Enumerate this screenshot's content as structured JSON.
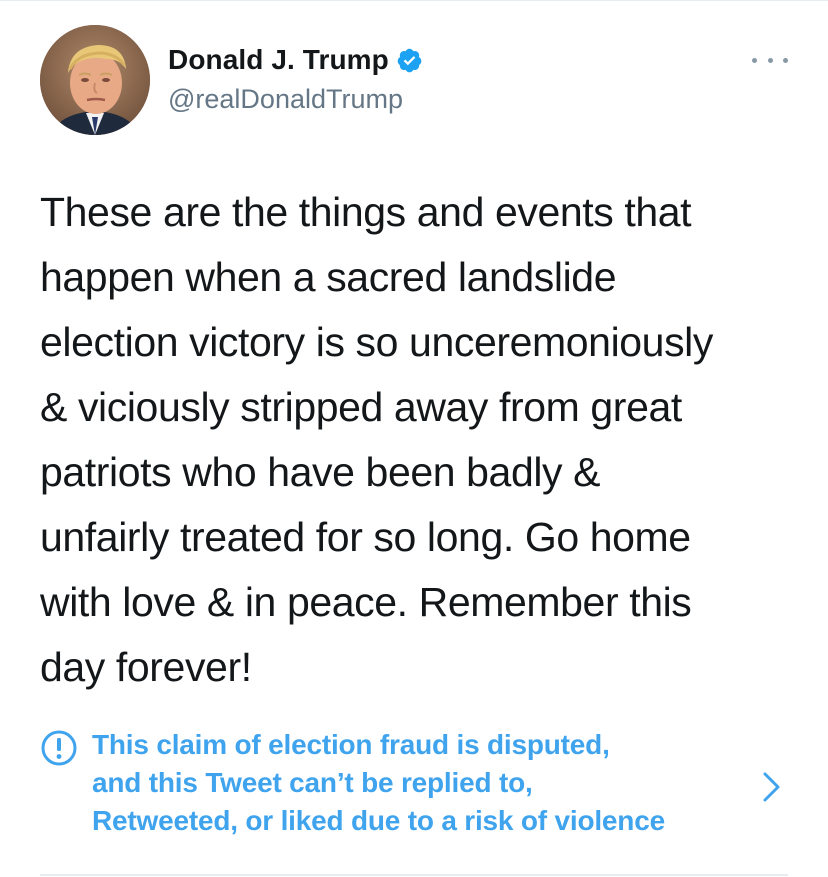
{
  "author": {
    "display_name": "Donald J. Trump",
    "handle": "@realDonaldTrump",
    "verified": true
  },
  "tweet": {
    "lines": [
      "These are the things and events that",
      "happen when a sacred landslide",
      "election victory is so unceremoniously",
      "& viciously stripped away from great",
      "patriots who have been badly &",
      "unfairly treated for so long. Go home",
      "with love & in peace. Remember this",
      "day forever!"
    ]
  },
  "notice": {
    "lines": [
      "This claim of election fraud is disputed,",
      "and this Tweet can’t be replied to,",
      "Retweeted, or liked due to a risk of violence"
    ]
  },
  "icons": {
    "verified": "verified-badge-icon",
    "more": "more-options-icon",
    "notice": "exclamation-circle-icon",
    "chevron": "chevron-right-icon"
  },
  "colors": {
    "accent": "#1da1f2",
    "notice_text": "#3fa4ed",
    "secondary_text": "#657786",
    "primary_text": "#14171a"
  }
}
